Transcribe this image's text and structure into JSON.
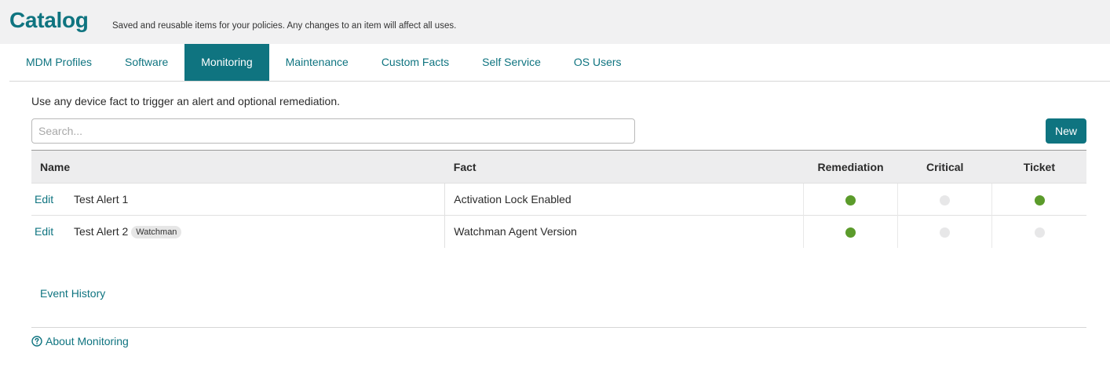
{
  "header": {
    "title": "Catalog",
    "subtitle": "Saved and reusable items for your policies. Any changes to an item will affect all uses."
  },
  "tabs": [
    {
      "label": "MDM Profiles",
      "active": false
    },
    {
      "label": "Software",
      "active": false
    },
    {
      "label": "Monitoring",
      "active": true
    },
    {
      "label": "Maintenance",
      "active": false
    },
    {
      "label": "Custom Facts",
      "active": false
    },
    {
      "label": "Self Service",
      "active": false
    },
    {
      "label": "OS Users",
      "active": false
    }
  ],
  "main": {
    "intro": "Use any device fact to trigger an alert and optional remediation.",
    "search": {
      "placeholder": "Search...",
      "value": ""
    },
    "new_label": "New",
    "table": {
      "columns": [
        "Name",
        "Fact",
        "Remediation",
        "Critical",
        "Ticket"
      ],
      "rows": [
        {
          "edit": "Edit",
          "name": "Test Alert 1",
          "badge": "",
          "fact": "Activation Lock Enabled",
          "remediation": true,
          "critical": false,
          "ticket": true
        },
        {
          "edit": "Edit",
          "name": "Test Alert 2",
          "badge": "Watchman",
          "fact": "Watchman Agent Version",
          "remediation": true,
          "critical": false,
          "ticket": false
        }
      ]
    },
    "event_history": "Event History",
    "about": "About Monitoring"
  },
  "colors": {
    "accent": "#0f7480",
    "status_on": "#5b9b2b",
    "status_off": "#e7e7e8"
  },
  "icons": {
    "about": "question-circle-icon"
  }
}
